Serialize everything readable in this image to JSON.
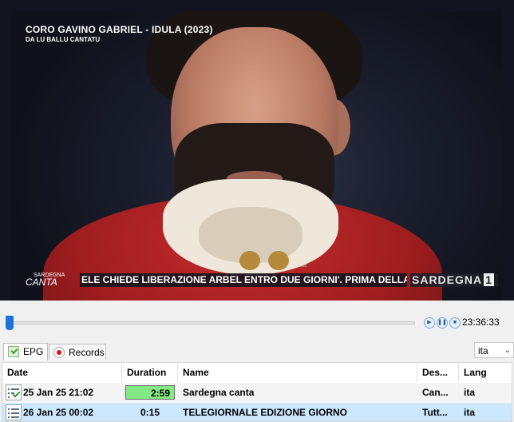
{
  "video": {
    "overlay_title": "CORO GAVINO GABRIEL - IDULA (2023)",
    "overlay_subtitle": "DA LU BALLU CANTATU",
    "canta_logo_top": "SARDEGNA",
    "canta_logo_bottom": "CANTA",
    "ticker_text": "ELE CHIEDE LIBERAZIONE ARBEL ENTRO DUE GIORNI'. PRIMA DELLA I",
    "channel_name": "SARDEGNA",
    "channel_number": "1"
  },
  "playback": {
    "time": "23:36:33",
    "position_fraction": 0.0,
    "play_icon": "play-icon",
    "pause_icon": "pause-icon",
    "stop_icon": "stop-icon"
  },
  "tabs": [
    {
      "label": "EPG",
      "icon": "epg-icon",
      "active": true
    },
    {
      "label": "Records",
      "icon": "record-icon",
      "active": false
    }
  ],
  "language_select": {
    "value": "ita"
  },
  "table": {
    "columns": [
      "Date",
      "Duration",
      "Name",
      "Des...",
      "Lang"
    ],
    "rows": [
      {
        "date": "25 Jan 25 21:02",
        "duration": "2:59",
        "name": "Sardegna canta",
        "desc": "Can...",
        "lang": "ita",
        "status": "recorded"
      },
      {
        "date": "26 Jan 25 00:02",
        "duration": "0:15",
        "name": "TELEGIORNALE EDIZIONE GIORNO",
        "desc": "Tutt...",
        "lang": "ita",
        "status": "scheduled"
      }
    ],
    "colors": {
      "selected_row": "#cce8ff",
      "duration_highlight": "#84e884"
    }
  }
}
